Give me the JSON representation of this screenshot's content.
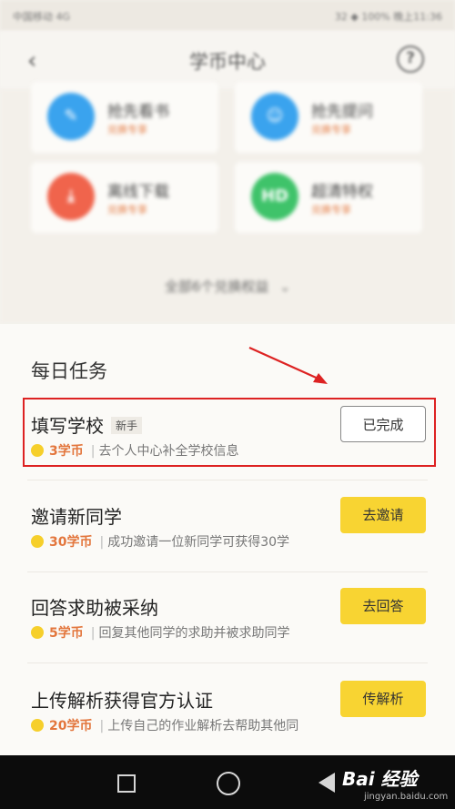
{
  "status_bar": {
    "left_text": "中国移动 4G",
    "right_text": "32 ◆ 100% 晚上11:36"
  },
  "header": {
    "title": "学币中心",
    "back_symbol": "‹",
    "help_symbol": "?"
  },
  "benefits": {
    "items": [
      {
        "name": "抢先看书",
        "sub": "兑换专享",
        "icon": "book-icon",
        "color": "#3aa3ee"
      },
      {
        "name": "抢先提问",
        "sub": "兑换专享",
        "icon": "user-icon",
        "color": "#3aa3ee"
      },
      {
        "name": "离线下载",
        "sub": "兑换专享",
        "icon": "download-icon",
        "color": "#f0644c"
      },
      {
        "name": "超清特权",
        "sub": "兑换专享",
        "icon": "hd-icon",
        "color": "#3fc36a"
      }
    ],
    "all_label": "全部6个兑换权益",
    "icon_labels": {
      "hd": "HD"
    }
  },
  "tasks": {
    "title": "每日任务",
    "items": [
      {
        "name": "填写学校",
        "badge": "新手",
        "reward": "3学币",
        "desc": "去个人中心补全学校信息",
        "button": "已完成",
        "done": true
      },
      {
        "name": "邀请新同学",
        "reward": "30学币",
        "desc": "成功邀请一位新同学可获得30学",
        "button": "去邀请",
        "done": false
      },
      {
        "name": "回答求助被采纳",
        "reward": "5学币",
        "desc": "回复其他同学的求助并被求助同学",
        "button": "去回答",
        "done": false
      },
      {
        "name": "上传解析获得官方认证",
        "reward": "20学币",
        "desc": "上传自己的作业解析去帮助其他同",
        "button": "传解析",
        "done": false
      }
    ]
  },
  "watermark": {
    "brand": "Bai 经验",
    "url": "jingyan.baidu.com"
  },
  "colors": {
    "accent_yellow": "#f8d432",
    "reward_orange": "#e3763d",
    "highlight_red": "#dd2222"
  }
}
